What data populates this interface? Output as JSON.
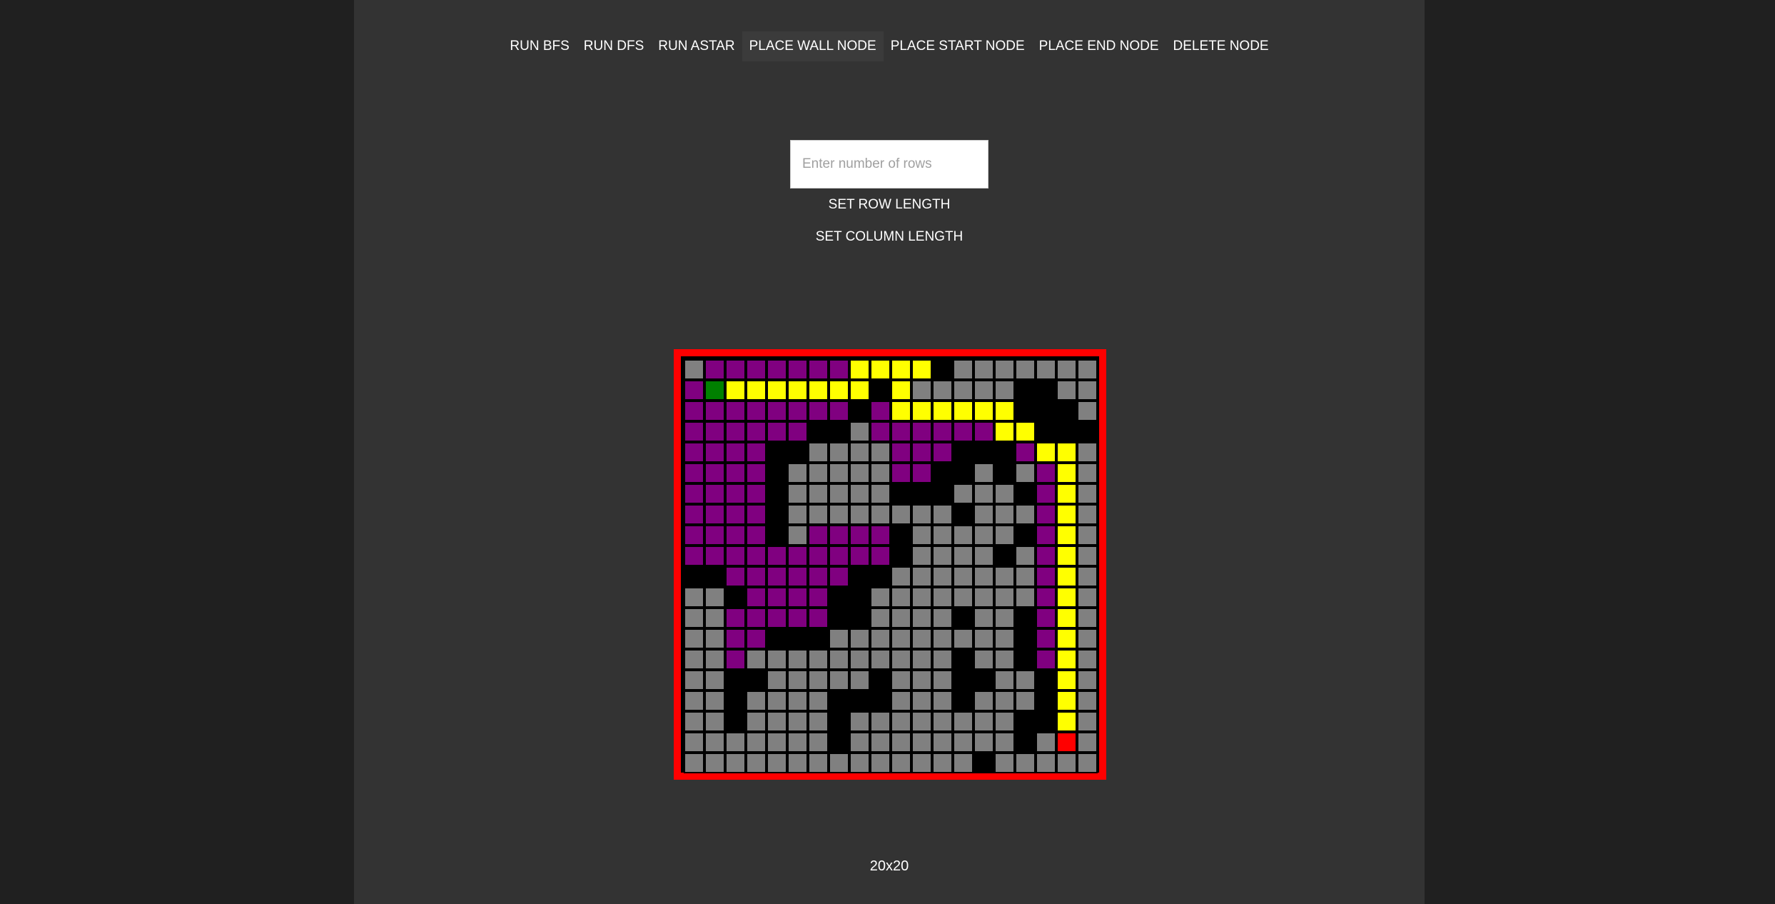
{
  "toolbar": {
    "run_bfs": "RUN BFS",
    "run_dfs": "RUN DFS",
    "run_astar": "RUN ASTAR",
    "place_wall": "PLACE WALL NODE",
    "place_start": "PLACE START NODE",
    "place_end": "PLACE END NODE",
    "delete_node": "DELETE NODE"
  },
  "controls": {
    "rows_placeholder": "Enter number of rows",
    "rows_value": "",
    "set_row_length": "SET ROW LENGTH",
    "set_column_length": "SET COLUMN LENGTH"
  },
  "grid": {
    "rows": 20,
    "cols": 20,
    "legend": {
      "0": "empty",
      "1": "wall",
      "2": "visited",
      "3": "path",
      "4": "start",
      "5": "end"
    },
    "colors": {
      "empty": "#808080",
      "wall": "#000000",
      "visited": "#800080",
      "path": "#ffff00",
      "start": "#008000",
      "end": "#ff0000",
      "border": "#ff0000"
    },
    "cells": [
      "02222222333310000000",
      "24333333313000001100",
      "22222222123333331110",
      "22222211022222233111",
      "22221100002221112330",
      "22221000002211010230",
      "22221000001110001230",
      "22221000000001000230",
      "22221022221000001230",
      "22222222221000010230",
      "11222222110000000230",
      "00122221100000000230",
      "00222221100001001230",
      "00221110000000001230",
      "00200000000001001230",
      "00110000010001100130",
      "00100001110001000130",
      "00100001000000001130",
      "00000001000000001050",
      "00000000000000100000"
    ]
  },
  "dimensions_label": "20x20"
}
